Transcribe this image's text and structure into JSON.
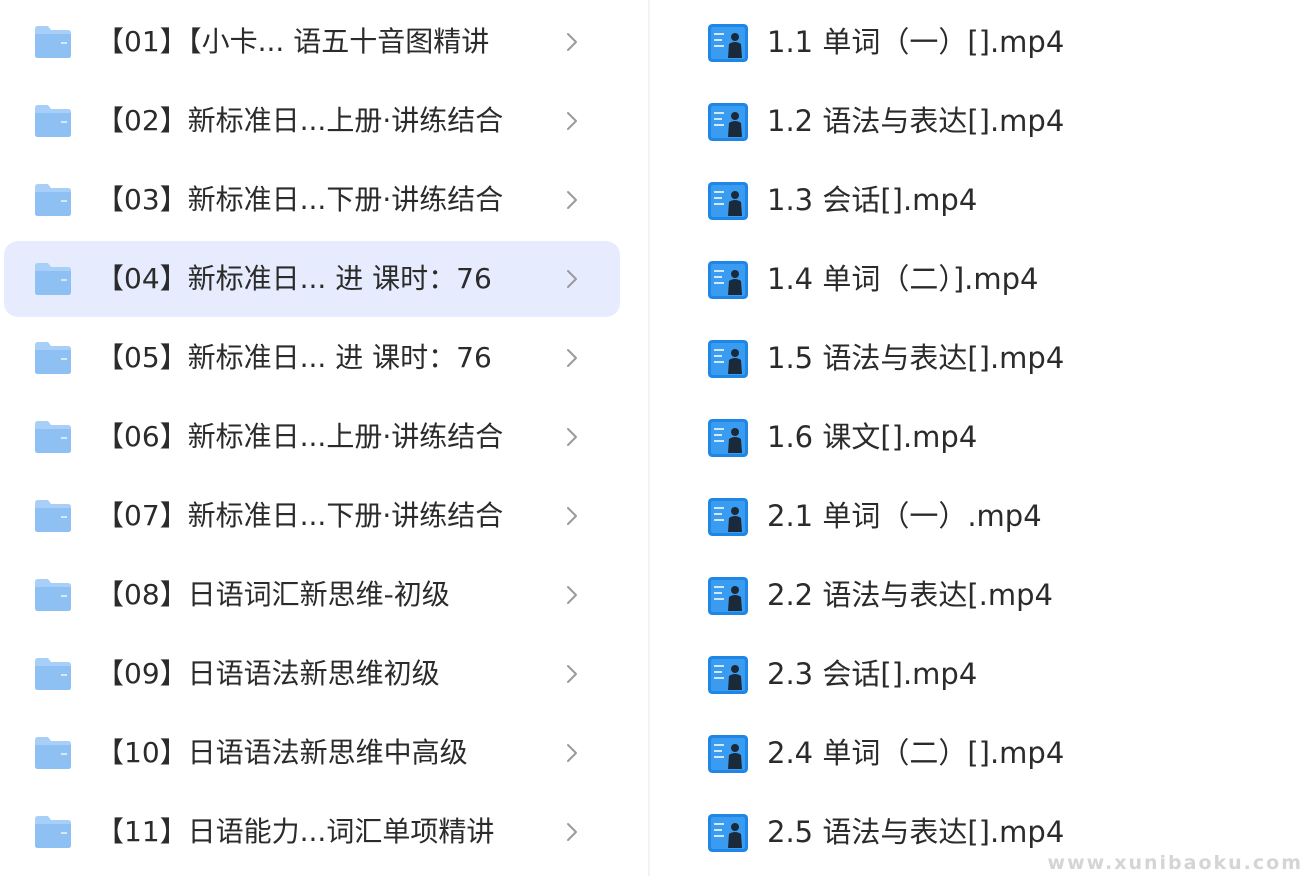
{
  "folders": [
    {
      "label": "【01】【小卡... 语五十音图精讲",
      "selected": false
    },
    {
      "label": "【02】新标准日...上册·讲练结合",
      "selected": false
    },
    {
      "label": "【03】新标准日...下册·讲练结合",
      "selected": false
    },
    {
      "label": "【04】新标准日...  进 课时：76",
      "selected": true
    },
    {
      "label": "【05】新标准日...  进 课时：76",
      "selected": false
    },
    {
      "label": "【06】新标准日...上册·讲练结合",
      "selected": false
    },
    {
      "label": "【07】新标准日...下册·讲练结合",
      "selected": false
    },
    {
      "label": "【08】日语词汇新思维-初级",
      "selected": false
    },
    {
      "label": "【09】日语语法新思维初级",
      "selected": false
    },
    {
      "label": "【10】日语语法新思维中高级",
      "selected": false
    },
    {
      "label": "【11】日语能力...词汇单项精讲",
      "selected": false
    }
  ],
  "files": [
    {
      "label": "1.1 单词（一）[].mp4"
    },
    {
      "label": "1.2 语法与表达[].mp4"
    },
    {
      "label": "1.3 会话[].mp4"
    },
    {
      "label": "1.4 单词（二）].mp4"
    },
    {
      "label": "1.5 语法与表达[].mp4"
    },
    {
      "label": "1.6 课文[].mp4"
    },
    {
      "label": "2.1 单词（一）.mp4"
    },
    {
      "label": "2.2 语法与表达[.mp4"
    },
    {
      "label": "2.3 会话[].mp4"
    },
    {
      "label": "2.4 单词（二）[].mp4"
    },
    {
      "label": "2.5 语法与表达[].mp4"
    }
  ],
  "watermark": "www.xunibaoku.com",
  "colors": {
    "selected_row_bg": "#e6ecfd",
    "folder_icon": "#9fc8f6",
    "video_icon": "#1f86e6",
    "chevron": "#9a9a9a"
  }
}
